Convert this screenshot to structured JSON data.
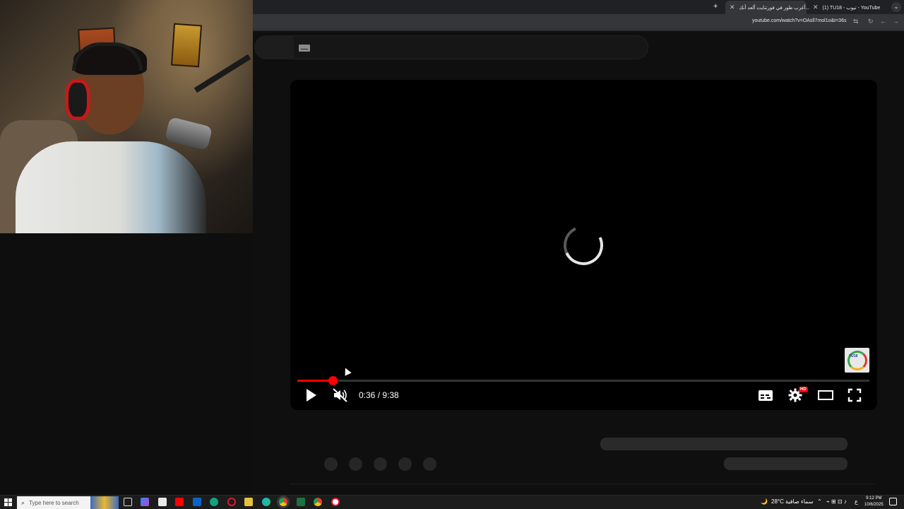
{
  "browser": {
    "tabs": [
      {
        "title": "(1) TU18 - تيوب - YouTube",
        "active": false
      },
      {
        "title": "أغرب طور في فورتنايت ألعد أنك...",
        "active": true
      }
    ],
    "new_tab_label": "+",
    "tab_menu_label": "⌄",
    "url": "youtube.com/watch?v=OAsll7mol1o&t=36s"
  },
  "player": {
    "current_time": "0:36",
    "duration": "9:38",
    "time_display": "0:36 / 9:38",
    "progress_fraction": 0.062,
    "quality_badge": "HD",
    "muted": true,
    "state": "loading",
    "channel_watermark_text": "TU18"
  },
  "taskbar": {
    "search_placeholder": "Type here to search",
    "weather_temp": "28°C",
    "weather_text": "سماء صافية",
    "language": "ع",
    "time": "9:12 PM",
    "date": "10/6/2025"
  },
  "colors": {
    "youtube_red": "#ff0000",
    "background": "#0f0f0f",
    "browser_chrome": "#202124"
  }
}
